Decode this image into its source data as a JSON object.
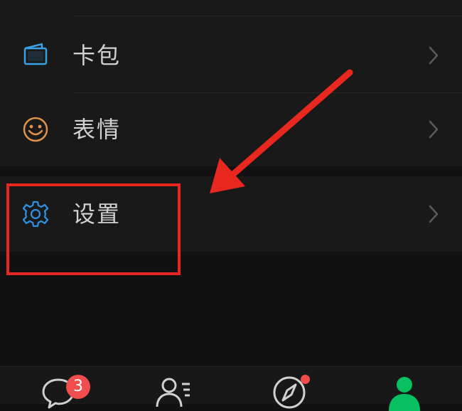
{
  "menu": {
    "items": [
      {
        "label": "卡包",
        "icon": "wallet-icon"
      },
      {
        "label": "表情",
        "icon": "smiley-icon"
      },
      {
        "label": "设置",
        "icon": "gear-icon"
      }
    ]
  },
  "tabbar": {
    "chats_badge": "3",
    "tabs": [
      {
        "icon": "chat-bubble-icon"
      },
      {
        "icon": "contacts-icon"
      },
      {
        "icon": "compass-icon"
      },
      {
        "icon": "profile-icon",
        "active": true
      }
    ]
  },
  "colors": {
    "background": "#111111",
    "card": "#191919",
    "text": "#d0d0d0",
    "accent_green": "#07c160",
    "badge_red": "#f04d4d",
    "annotation_red": "#e8281e",
    "wallet_blue": "#3aa0e6",
    "smiley_orange": "#e0914a",
    "gear_blue": "#2f8fe0"
  }
}
